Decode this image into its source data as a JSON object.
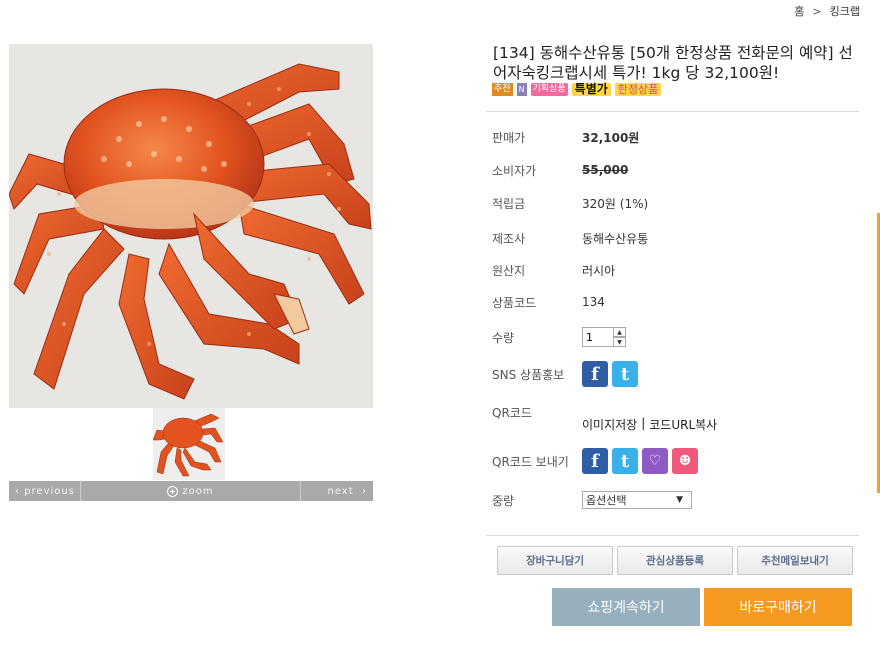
{
  "breadcrumb": {
    "home": "홈",
    "separator": ">",
    "category": "킹크랩"
  },
  "product": {
    "title": "[134] 동해수산유통 [50개 한정상품 전화문의 예약] 선어자숙킹크랩시세 특가! 1kg 당 32,100원!",
    "badges": {
      "recommend": "추천",
      "new": "N",
      "planned": "기획상품",
      "special": "특별가",
      "limited": "한정상품"
    }
  },
  "info": {
    "sale_price_label": "판매가",
    "sale_price": "32,100원",
    "consumer_price_label": "소비자가",
    "consumer_price": "55,000",
    "points_label": "적립금",
    "points": "320원 (1%)",
    "maker_label": "제조사",
    "maker": "동해수산유통",
    "origin_label": "원산지",
    "origin": "러시아",
    "code_label": "상품코드",
    "code": "134",
    "qty_label": "수량",
    "qty": "1",
    "sns_label": "SNS 상품홍보",
    "qr_label": "QR코드",
    "qr_save": "이미지저장",
    "qr_sep": "|",
    "qr_copy": "코드URL복사",
    "qr_send_label": "QR코드 보내기",
    "weight_label": "중량",
    "weight_select": "옵션선택"
  },
  "gallery": {
    "prev": "previous",
    "zoom": "zoom",
    "next": "next"
  },
  "buttons": {
    "cart": "장바구니담기",
    "wishlist": "관심상품등록",
    "recommend_mail": "추천메일보내기",
    "continue_shopping": "쇼핑계속하기",
    "buy_now": "바로구매하기"
  },
  "colors": {
    "price_blue": "#4a86b5",
    "buy_orange": "#f59a1f",
    "continue_gray": "#97b0bd"
  }
}
